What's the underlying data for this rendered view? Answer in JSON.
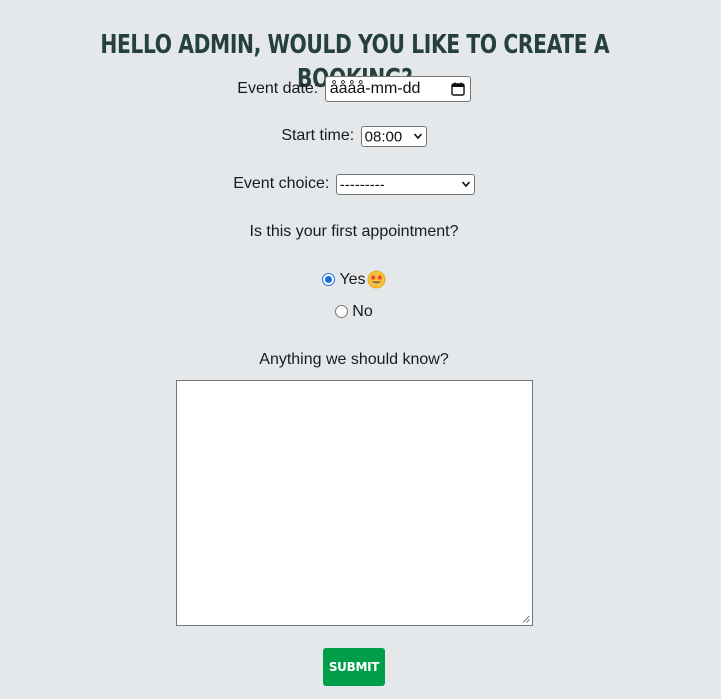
{
  "header": {
    "title": "HELLO ADMIN, WOULD YOU LIKE TO CREATE A BOOKING?"
  },
  "form": {
    "event_date_label": "Event date:",
    "event_date_value": "åååå-mm-dd",
    "start_time_label": "Start time:",
    "start_time_value": "08:00",
    "event_choice_label": "Event choice:",
    "event_choice_value": "---------",
    "first_appointment_question": "Is this your first appointment?",
    "radio_yes_label": "Yes",
    "radio_no_label": "No",
    "radio_selected": "Yes",
    "notes_label": "Anything we should know?",
    "notes_value": "",
    "submit_label": "SUBMIT"
  },
  "colors": {
    "background": "#e4e8eb",
    "title": "#26403a",
    "submit_button": "#009e49",
    "radio_accent": "#1a6ed8"
  },
  "icons": {
    "date_picker": "calendar-icon",
    "select_arrow": "chevron-down-icon",
    "yes_emoji": "star-struck-emoji-icon",
    "textarea_resize": "resize-handle-icon"
  }
}
